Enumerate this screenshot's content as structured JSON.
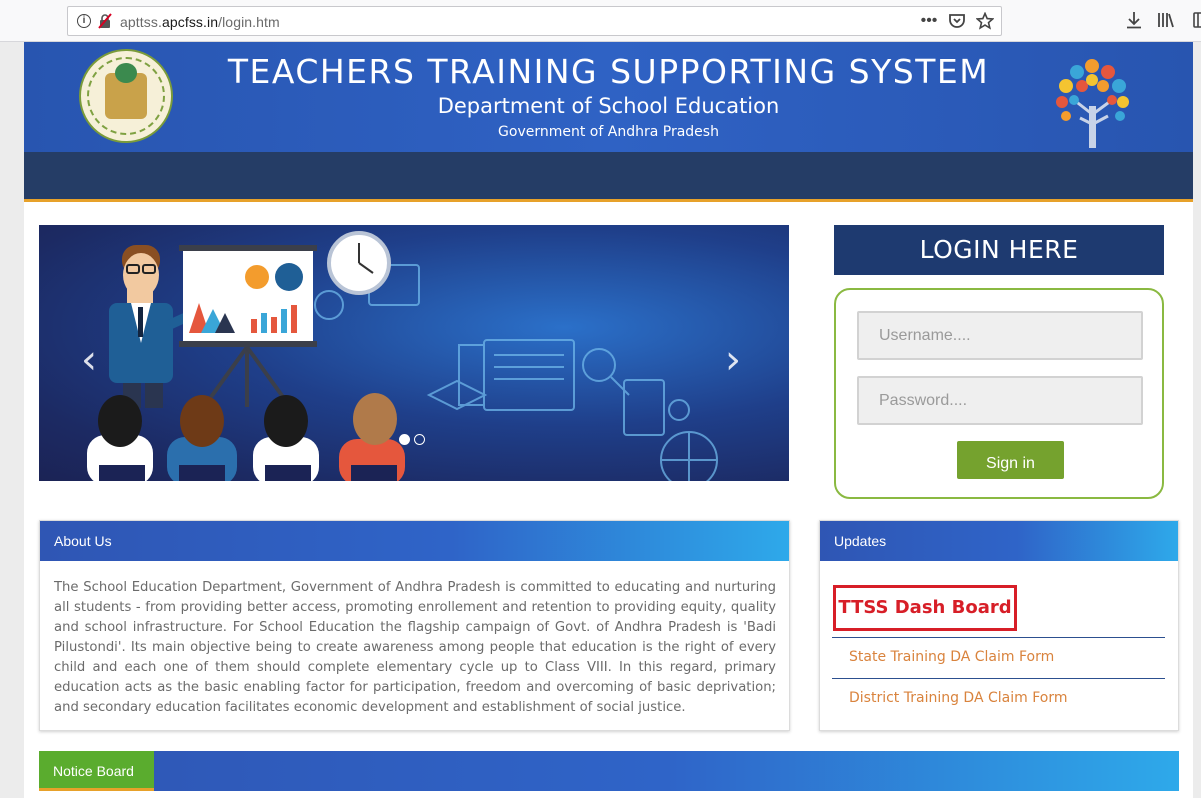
{
  "browser": {
    "url_path_prefix": "apttss.",
    "url_domain": "apcfss.in",
    "url_path": "/login.htm",
    "icons": [
      "info-icon",
      "insecure-lock-icon",
      "more-icon",
      "pocket-icon",
      "bookmark-star-icon",
      "download-icon",
      "library-icon",
      "sidebar-icon"
    ]
  },
  "header": {
    "title": "TEACHERS TRAINING SUPPORTING SYSTEM",
    "subtitle": "Department of School Education",
    "subtitle2": "Government of Andhra Pradesh"
  },
  "login": {
    "title": "LOGIN HERE",
    "username_placeholder": "Username....",
    "password_placeholder": "Password....",
    "signin_label": "Sign in"
  },
  "carousel": {
    "prev_label": "‹",
    "next_label": "›"
  },
  "about": {
    "title": "About Us",
    "text": "The School Education Department, Government of Andhra Pradesh is committed to educating and nurturing all students - from providing better access, promoting enrollement and retention to providing equity, quality and school infrastructure. For School Education the flagship campaign of Govt. of Andhra Pradesh is 'Badi Pilustondi'. Its main objective being to create awareness among people that education is the right of every child and each one of them should complete elementary cycle up to Class VIII. In this regard, primary education acts as the basic enabling factor for participation, freedom and overcoming of basic deprivation; and secondary education facilitates economic development and establishment of social justice."
  },
  "updates": {
    "title": "Updates",
    "dashboard_label": "TTSS Dash Board",
    "links": [
      "State Training DA Claim Form",
      "District Training DA Claim Form"
    ]
  },
  "notice": {
    "title": "Notice Board"
  },
  "colors": {
    "header_blue": "#2a5bb8",
    "nav_navy": "#253d66",
    "accent_orange": "#e7a12a",
    "login_green": "#75a22e",
    "dash_red": "#d71e27",
    "link_orange": "#d9833d"
  }
}
